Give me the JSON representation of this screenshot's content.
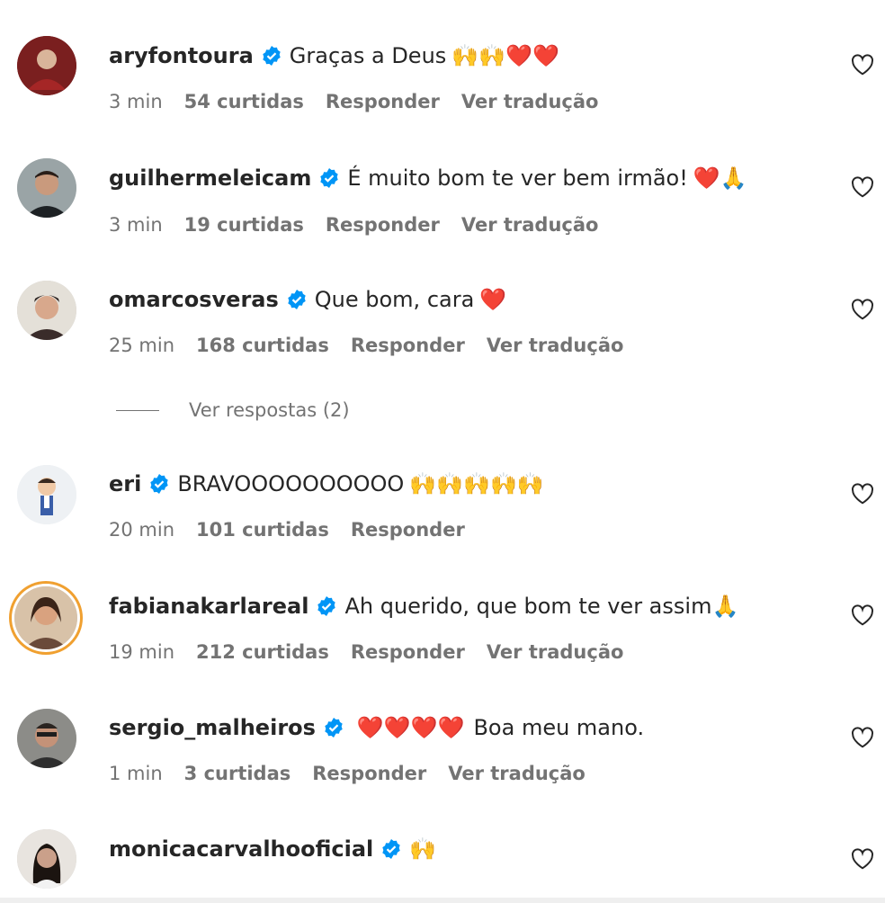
{
  "comments": [
    {
      "username": "aryfontoura",
      "text": "Graças a Deus",
      "emoji": "🙌🙌❤️❤️",
      "time": "3 min",
      "likes": "54 curtidas",
      "reply": "Responder",
      "translate": "Ver tradução"
    },
    {
      "username": "guilhermeleicam",
      "text": "É muito bom te ver bem irmão!",
      "emoji": "❤️🙏",
      "time": "3 min",
      "likes": "19 curtidas",
      "reply": "Responder",
      "translate": "Ver tradução"
    },
    {
      "username": "omarcosveras",
      "text": "Que bom, cara",
      "emoji": "❤️",
      "time": "25 min",
      "likes": "168 curtidas",
      "reply": "Responder",
      "translate": "Ver tradução"
    },
    {
      "username": "eri",
      "text": "BRAVOOOOOOOOOO",
      "emoji": "🙌🙌🙌🙌🙌",
      "time": "20 min",
      "likes": "101 curtidas",
      "reply": "Responder",
      "translate": ""
    },
    {
      "username": "fabianakarlareal",
      "text": "Ah querido, que bom te ver assim",
      "emoji": "🙏",
      "time": "19 min",
      "likes": "212 curtidas",
      "reply": "Responder",
      "translate": "Ver tradução"
    },
    {
      "username": "sergio_malheiros",
      "text": "Boa meu mano.",
      "emoji": "❤️❤️❤️❤️",
      "time": "1 min",
      "likes": "3 curtidas",
      "reply": "Responder",
      "translate": "Ver tradução"
    },
    {
      "username": "monicacarvalhooficial",
      "text": "",
      "emoji": "🙌",
      "time": "",
      "likes": "",
      "reply": "",
      "translate": ""
    }
  ],
  "replies_label": "Ver respostas (2)",
  "colors": {
    "verified": "#0095f6",
    "muted": "#737373",
    "text": "#262626",
    "story_ring": "#f0a030"
  },
  "icons": {
    "verified": "verified-badge-icon",
    "like": "heart-outline-icon"
  }
}
